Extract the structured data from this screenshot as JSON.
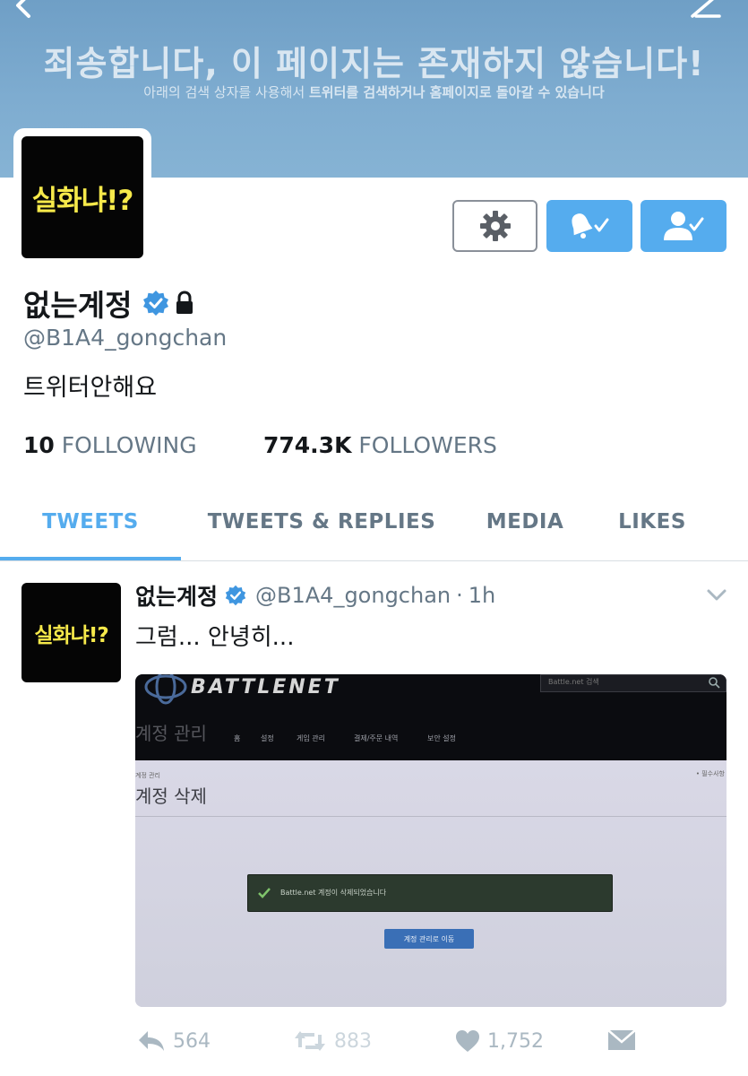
{
  "banner": {
    "error_title": "죄송합니다, 이 페이지는 존재하지 않습니다!",
    "error_sub_plain": "아래의 검색 상자를 사용해서 ",
    "error_sub_bold": "트위터를 검색하거나 홈페이지로 돌아갈 수 있습니다",
    "color": "#7eacd0"
  },
  "profile": {
    "avatar_text": "실화냐!?",
    "display_name": "없는계정",
    "handle": "@B1A4_gongchan",
    "bio": "트위터안해요",
    "verified": true,
    "protected": true,
    "following_count": "10",
    "following_label": "FOLLOWING",
    "followers_count": "774.3K",
    "followers_label": "FOLLOWERS"
  },
  "buttons": {
    "settings_icon": "gear-icon",
    "notify_icon": "bell-check-icon",
    "follow_icon": "person-check-icon",
    "accent_color": "#55acee"
  },
  "tabs": [
    {
      "label": "TWEETS",
      "active": true
    },
    {
      "label": "TWEETS & REPLIES",
      "active": false
    },
    {
      "label": "MEDIA",
      "active": false
    },
    {
      "label": "LIKES",
      "active": false
    }
  ],
  "tweet": {
    "avatar_text": "실화냐!?",
    "name": "없는계정",
    "handle": "@B1A4_gongchan",
    "separator": "·",
    "time": "1h",
    "text": "그럼... 안녕히...",
    "photo": {
      "logo": "BATTLENET",
      "search_placeholder": "Battle.net 검색",
      "section_title": "계정 관리",
      "nav_items": [
        "홈",
        "설정",
        "게임 관리",
        "결제/주문 내역",
        "보안 설정"
      ],
      "breadcrumb": "계정 관리",
      "required_note": "• 필수사항",
      "page_heading": "계정 삭제",
      "success_message": "Battle.net 계정이 삭제되었습니다",
      "button_label": "계정 관리로 이동"
    },
    "actions": {
      "replies": "564",
      "retweets": "883",
      "likes": "1,752"
    }
  }
}
